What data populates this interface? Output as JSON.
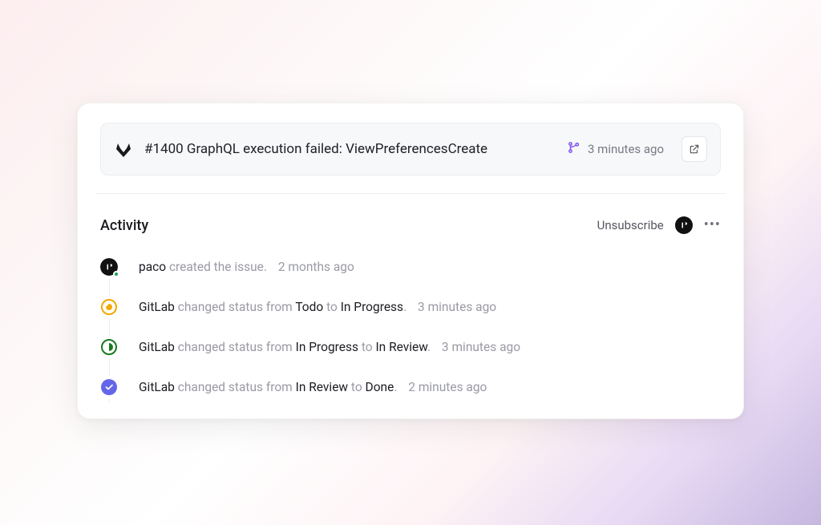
{
  "issue": {
    "number_prefix": "#1400",
    "title": "GraphQL execution failed: ViewPreferencesCreate",
    "time": "3 minutes ago"
  },
  "activity": {
    "heading": "Activity",
    "unsubscribe_label": "Unsubscribe"
  },
  "items": [
    {
      "actor": "paco",
      "verb": " created the issue.",
      "time": "2 months ago",
      "node_type": "avatar"
    },
    {
      "actor": "GitLab",
      "verb_prefix": " changed status from ",
      "from": "Todo",
      "mid": " to ",
      "to": "In Progress",
      "suffix": ".",
      "time": "3 minutes ago",
      "node_type": "todo"
    },
    {
      "actor": "GitLab",
      "verb_prefix": " changed status from ",
      "from": "In Progress",
      "mid": " to ",
      "to": "In Review",
      "suffix": ".",
      "time": "3 minutes ago",
      "node_type": "progress"
    },
    {
      "actor": "GitLab",
      "verb_prefix": " changed status from ",
      "from": "In Review",
      "mid": " to ",
      "to": "Done",
      "suffix": ".",
      "time": "2 minutes ago",
      "node_type": "done"
    }
  ]
}
